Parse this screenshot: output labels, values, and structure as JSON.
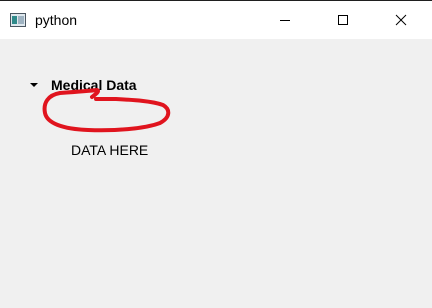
{
  "window": {
    "title": "python",
    "controls": {
      "minimize_icon": "minimize-icon",
      "maximize_icon": "maximize-icon",
      "close_icon": "close-icon"
    }
  },
  "tree": {
    "group_label": "Medical Data",
    "expanded": true,
    "expand_icon": "chevron-down-icon",
    "child_text": "DATA HERE"
  },
  "annotation": {
    "shape": "hand-drawn-ellipse",
    "color": "#e0141e"
  }
}
